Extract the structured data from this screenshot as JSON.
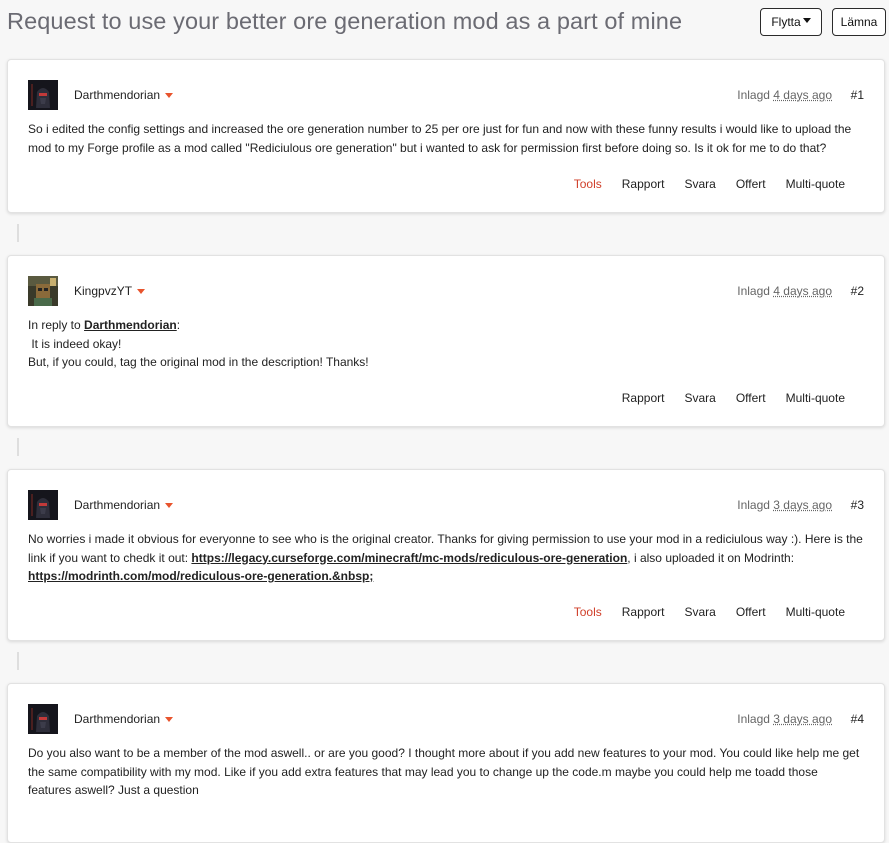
{
  "page": {
    "title": "Request to use your better ore generation mod as a part of mine",
    "move_label": "Flytta",
    "leave_label": "Lämna"
  },
  "posts": [
    {
      "author": "Darthmendorian",
      "posted_prefix": "Inlagd",
      "posted_ago": "4 days ago",
      "number": "#1",
      "body": "So i edited the config settings and increased the ore generation number to 25 per ore just for fun and now with these funny results i would like to upload the mod to my Forge profile as a mod called \"Rediciulous ore generation\" but i wanted to ask for permission first before doing so. Is it ok for me to do that?",
      "actions": [
        "Tools",
        "Rapport",
        "Svara",
        "Offert",
        "Multi-quote"
      ]
    },
    {
      "author": "KingpvzYT",
      "posted_prefix": "Inlagd",
      "posted_ago": "4 days ago",
      "number": "#2",
      "reply_prefix": "In reply to",
      "reply_to": "Darthmendorian",
      "reply_colon": ":",
      "line1": " It is indeed okay!",
      "line2": "But, if you could, tag the original mod in the description! Thanks!",
      "actions": [
        "Rapport",
        "Svara",
        "Offert",
        "Multi-quote"
      ]
    },
    {
      "author": "Darthmendorian",
      "posted_prefix": "Inlagd",
      "posted_ago": "3 days ago",
      "number": "#3",
      "text1": "No worries i made it obvious for everyonne to see who is the original creator. Thanks for giving permission to use your mod in a rediciulous way :). Here is the link if you want to chedk it out: ",
      "link1": "https://legacy.curseforge.com/minecraft/mc-mods/rediculous-ore-generation",
      "text2": ", i also uploaded it on Modrinth: ",
      "link2": "https://modrinth.com/mod/rediculous-ore-generation.&nbsp;",
      "actions": [
        "Tools",
        "Rapport",
        "Svara",
        "Offert",
        "Multi-quote"
      ]
    },
    {
      "author": "Darthmendorian",
      "posted_prefix": "Inlagd",
      "posted_ago": "3 days ago",
      "number": "#4",
      "body": "Do you also want to be a member of the mod aswell.. or are you good? I thought more about if you add new features to your mod. You could like help me get the same compatibility with my mod. Like if you add extra features that may lead you to change up the code.m maybe you could help me toadd those features aswell? Just a question"
    }
  ],
  "colors": {
    "accent": "#e8542d",
    "tools": "#d0402b",
    "title": "#6b6b73"
  }
}
